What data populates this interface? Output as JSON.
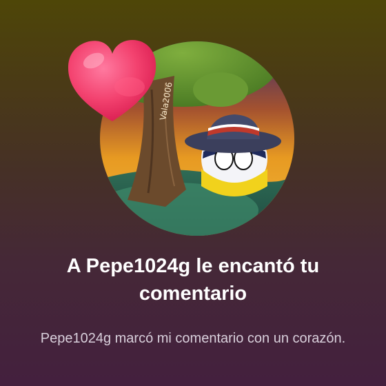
{
  "notification": {
    "title": "A Pepe1024g le encantó tu comentario",
    "message": "Pepe1024g marcó mi comentario con un corazón.",
    "avatar_signature": "Vala2006",
    "icon": "heart-icon",
    "colors": {
      "heart": "#f3426f",
      "title_text": "#ffffff",
      "message_text": "#d9d0dc"
    }
  }
}
